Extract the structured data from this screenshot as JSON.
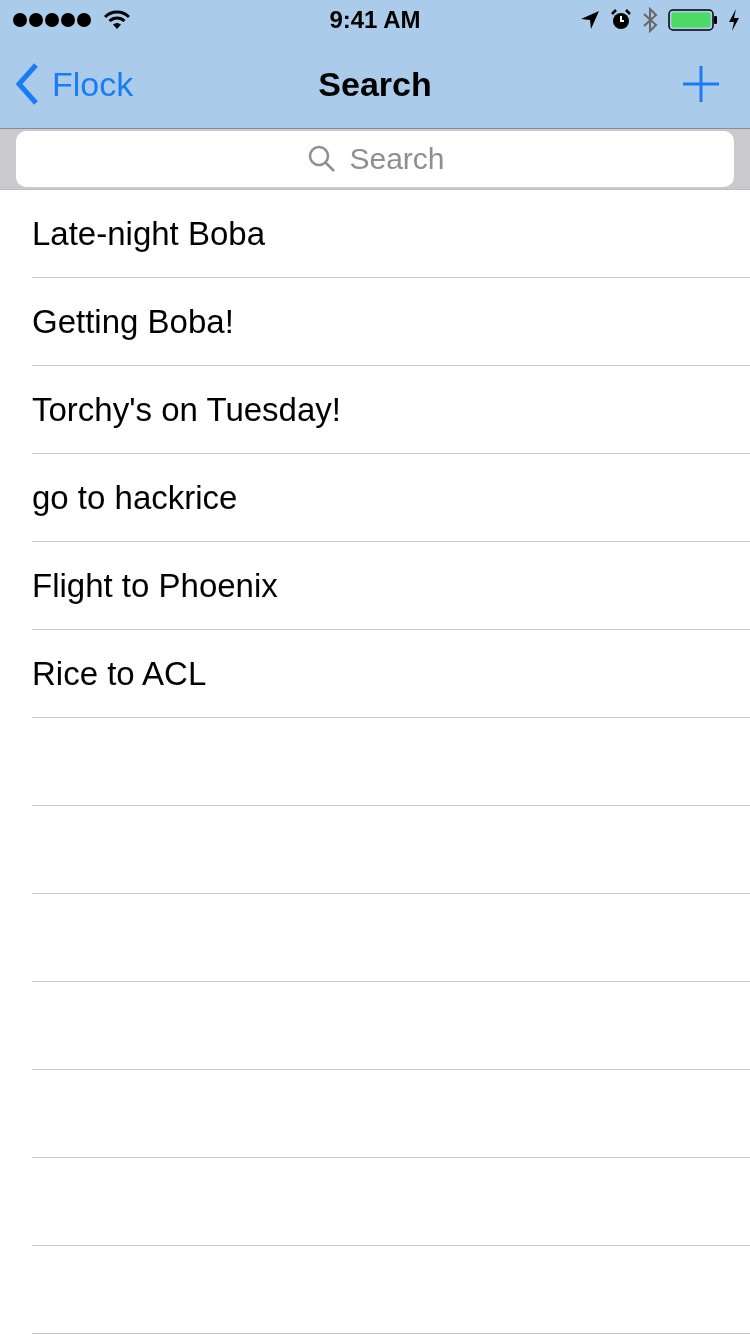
{
  "status_bar": {
    "time": "9:41 AM"
  },
  "nav_bar": {
    "back_label": "Flock",
    "title": "Search"
  },
  "search": {
    "placeholder": "Search"
  },
  "list": [
    {
      "title": "Late-night Boba"
    },
    {
      "title": "Getting Boba!"
    },
    {
      "title": "Torchy's on Tuesday!"
    },
    {
      "title": "go to hackrice"
    },
    {
      "title": "Flight to Phoenix"
    },
    {
      "title": "Rice to ACL"
    }
  ]
}
